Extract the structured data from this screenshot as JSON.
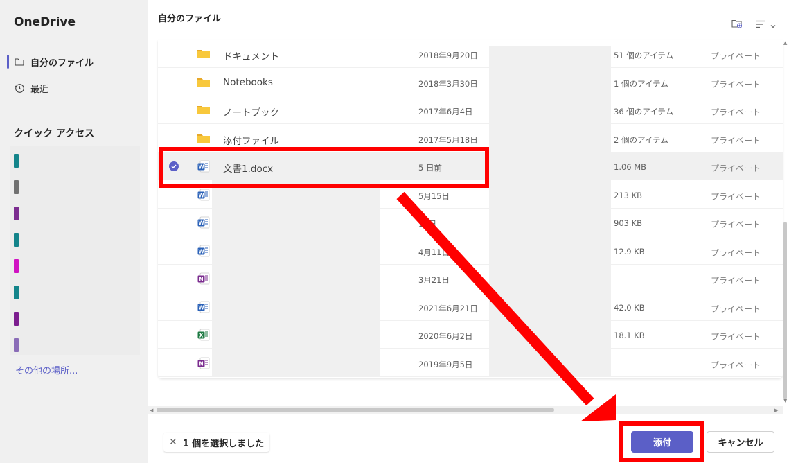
{
  "sidebar": {
    "brand": "OneDrive",
    "nav": [
      {
        "label": "自分のファイル",
        "icon": "folder-icon",
        "active": true
      },
      {
        "label": "最近",
        "icon": "history-icon",
        "active": false
      }
    ],
    "quick_access_title": "クイック アクセス",
    "quick_access_colors": [
      "#13848a",
      "#707070",
      "#7b2c8f",
      "#13848a",
      "#d013c2",
      "#13848a",
      "#7b1d8e",
      "#8a6cb7"
    ],
    "more_link": "その他の場所..."
  },
  "main": {
    "title": "自分のファイル",
    "top_icons": [
      "new-folder-icon",
      "sort-icon",
      "chevron-down-icon"
    ],
    "rows": [
      {
        "type": "folder",
        "name": "ドキュメント",
        "date": "2018年9月20日",
        "size": "51 個のアイテム",
        "sharing": "プライベート"
      },
      {
        "type": "folder",
        "name": "Notebooks",
        "date": "2018年3月30日",
        "size": "1 個のアイテム",
        "sharing": "プライベート"
      },
      {
        "type": "folder",
        "name": "ノートブック",
        "date": "2017年6月4日",
        "size": "36 個のアイテム",
        "sharing": "プライベート"
      },
      {
        "type": "folder",
        "name": "添付ファイル",
        "date": "2017年5月18日",
        "size": "2 個のアイテム",
        "sharing": "プライベート"
      },
      {
        "type": "word",
        "name": "文書1.docx",
        "date": "5 日前",
        "size": "1.06 MB",
        "sharing": "プライベート",
        "selected": true
      },
      {
        "type": "word",
        "name": "",
        "date": "5月15日",
        "size": "213 KB",
        "sharing": "プライベート"
      },
      {
        "type": "word",
        "name": "",
        "date": "14日",
        "size": "903 KB",
        "sharing": "プライベート"
      },
      {
        "type": "word",
        "name": "",
        "date": "4月11日",
        "size": "12.9 KB",
        "sharing": "プライベート"
      },
      {
        "type": "onenote",
        "name": "",
        "date": "3月21日",
        "size": "",
        "sharing": "プライベート"
      },
      {
        "type": "word",
        "name": "",
        "date": "2021年6月21日",
        "size": "42.0 KB",
        "sharing": "プライベート"
      },
      {
        "type": "excel",
        "name": "",
        "date": "2020年6月2日",
        "size": "18.1 KB",
        "sharing": "プライベート"
      },
      {
        "type": "onenote",
        "name": "",
        "date": "2019年9月5日",
        "size": "",
        "sharing": "プライベート"
      }
    ]
  },
  "footer": {
    "selection_text": "1 個を選択しました",
    "attach_label": "添付",
    "cancel_label": "キャンセル"
  },
  "colors": {
    "accent": "#5b5fc7",
    "annotation": "#ff0000",
    "folder": "#f8c83c",
    "word": "#2b62b8",
    "excel": "#1d7a43",
    "onenote": "#7b2c8f"
  }
}
